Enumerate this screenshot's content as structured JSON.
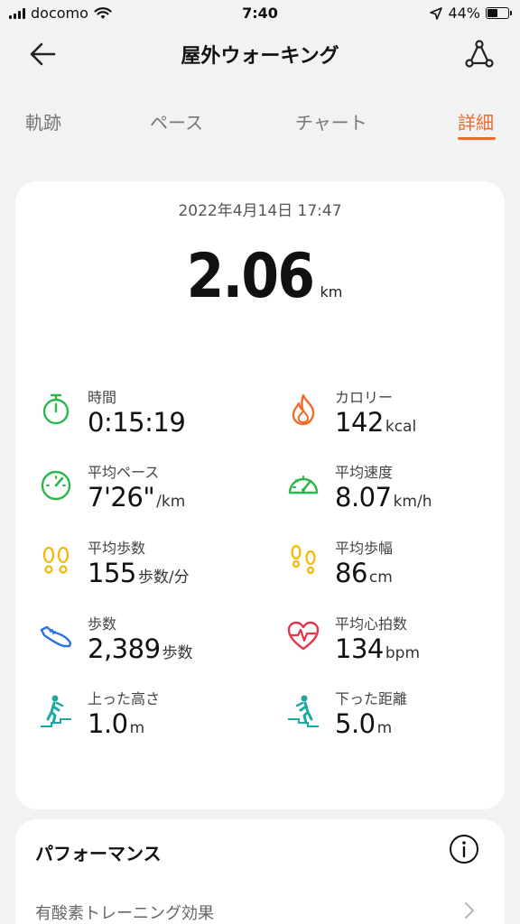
{
  "status_bar": {
    "carrier": "docomo",
    "time": "7:40",
    "battery": "44%"
  },
  "header": {
    "title": "屋外ウォーキング"
  },
  "tabs": [
    {
      "label": "軌跡"
    },
    {
      "label": "ペース"
    },
    {
      "label": "チャート"
    },
    {
      "label": "詳細",
      "active": true
    }
  ],
  "summary": {
    "date": "2022年4月14日 17:47",
    "distance": "2.06",
    "distance_unit": "km"
  },
  "metrics": [
    {
      "label": "時間",
      "value": "0:15:19",
      "unit": "",
      "icon": "stopwatch-icon"
    },
    {
      "label": "カロリー",
      "value": "142",
      "unit": "kcal",
      "icon": "flame-icon"
    },
    {
      "label": "平均ペース",
      "value": "7'26\"",
      "unit": "/km",
      "icon": "pace-gauge-icon"
    },
    {
      "label": "平均速度",
      "value": "8.07",
      "unit": "km/h",
      "icon": "speedometer-icon"
    },
    {
      "label": "平均歩数",
      "value": "155",
      "unit": "歩数/分",
      "icon": "footprints-icon"
    },
    {
      "label": "平均歩幅",
      "value": "86",
      "unit": "cm",
      "icon": "stride-icon"
    },
    {
      "label": "歩数",
      "value": "2,389",
      "unit": "歩数",
      "icon": "shoe-icon"
    },
    {
      "label": "平均心拍数",
      "value": "134",
      "unit": "bpm",
      "icon": "heart-rate-icon"
    },
    {
      "label": "上った高さ",
      "value": "1.0",
      "unit": "m",
      "icon": "climb-up-icon"
    },
    {
      "label": "下った距離",
      "value": "5.0",
      "unit": "m",
      "icon": "climb-down-icon"
    }
  ],
  "performance": {
    "title": "パフォーマンス",
    "item": "有酸素トレーニング効果"
  },
  "colors": {
    "accent": "#ee6a2a",
    "green": "#2ab84a",
    "teal": "#1aa9a3",
    "yellow": "#f5b800",
    "orange": "#f06a2a",
    "blue": "#2a74e6",
    "red": "#e8344a"
  }
}
